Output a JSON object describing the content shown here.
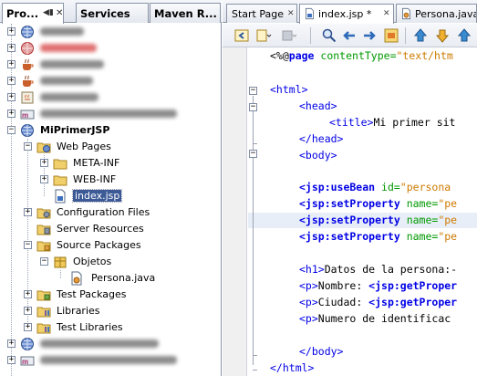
{
  "left_panel": {
    "tabs": [
      {
        "label": "Pro...",
        "active": true
      },
      {
        "label": "Services",
        "active": false
      },
      {
        "label": "Maven R...",
        "active": false
      }
    ],
    "tree": {
      "project_name": "MiPrimerJSP",
      "web_pages": "Web Pages",
      "meta_inf": "META-INF",
      "web_inf": "WEB-INF",
      "index_file": "index.jsp",
      "config_files": "Configuration Files",
      "server_resources": "Server Resources",
      "source_packages": "Source Packages",
      "package": "Objetos",
      "java_file": "Persona.java",
      "test_packages": "Test Packages",
      "libraries": "Libraries",
      "test_libraries": "Test Libraries"
    }
  },
  "editor": {
    "tabs": [
      {
        "label": "Start Page"
      },
      {
        "label": "index.jsp *"
      },
      {
        "label": "Persona.java"
      }
    ],
    "code": {
      "l1_a": "<%@",
      "l1_b": "page",
      "l1_c": " contentType=",
      "l1_d": "\"text/htm",
      "l3": "<html>",
      "l4": "<head>",
      "l5_a": "<title>",
      "l5_b": "Mi primer sit",
      "l6": "</head>",
      "l7": "<body>",
      "l9_a": "<jsp:useBean",
      "l9_b": " id=",
      "l9_c": "\"persona",
      "set_prop": "<jsp:setProperty",
      "name_attr": " name=",
      "name_val": "\"pe",
      "l14_a": "<h1>",
      "l14_b": "Datos de la persona:-",
      "l15_a": "<p>",
      "l15_b": "Nombre: ",
      "l15_c": "<jsp:getProper",
      "l16_a": "<p>",
      "l16_b": "Ciudad: ",
      "l16_c": "<jsp:getProper",
      "l17_a": "<p>",
      "l17_b": "Numero de identificac",
      "l19": "</body>",
      "l20": "</html>"
    }
  },
  "colors": {
    "selection": "#3c5a96",
    "keyword": "#0000e6",
    "attribute": "#009900",
    "string": "#ce7b00",
    "current_line": "#e8eef8"
  }
}
